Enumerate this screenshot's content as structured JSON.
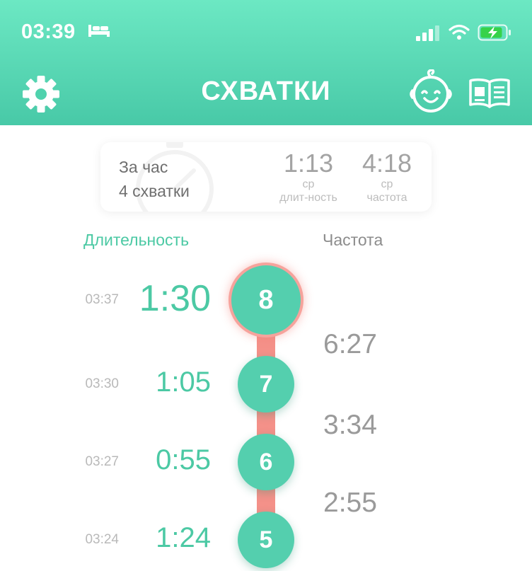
{
  "status_bar": {
    "time": "03:39",
    "bed_icon": "bed-icon",
    "signal_icon": "cellular-signal-icon",
    "wifi_icon": "wifi-icon",
    "battery_icon": "battery-charging-icon"
  },
  "header": {
    "title": "СХВАТКИ",
    "settings_icon": "gear-icon",
    "baby_icon": "baby-face-icon",
    "book_icon": "book-icon"
  },
  "summary": {
    "period_label": "За час",
    "count_label": "4 схватки",
    "avg_duration": {
      "value": "1:13",
      "prefix": "ср",
      "label": "длит-ность"
    },
    "avg_frequency": {
      "value": "4:18",
      "prefix": "ср",
      "label": "частота"
    }
  },
  "columns": {
    "duration": "Длительность",
    "frequency": "Частота"
  },
  "contractions": [
    {
      "number": "8",
      "time": "03:37",
      "duration": "1:30",
      "active": true
    },
    {
      "number": "7",
      "time": "03:30",
      "duration": "1:05",
      "active": false
    },
    {
      "number": "6",
      "time": "03:27",
      "duration": "0:55",
      "active": false
    },
    {
      "number": "5",
      "time": "03:24",
      "duration": "1:24",
      "active": false
    }
  ],
  "intervals": [
    "6:27",
    "3:34",
    "2:55"
  ],
  "colors": {
    "accent": "#4cc9a4",
    "header_top": "#6ce8c3",
    "header_bottom": "#48c9a7",
    "connector": "#f49189",
    "node": "#54cfae"
  }
}
